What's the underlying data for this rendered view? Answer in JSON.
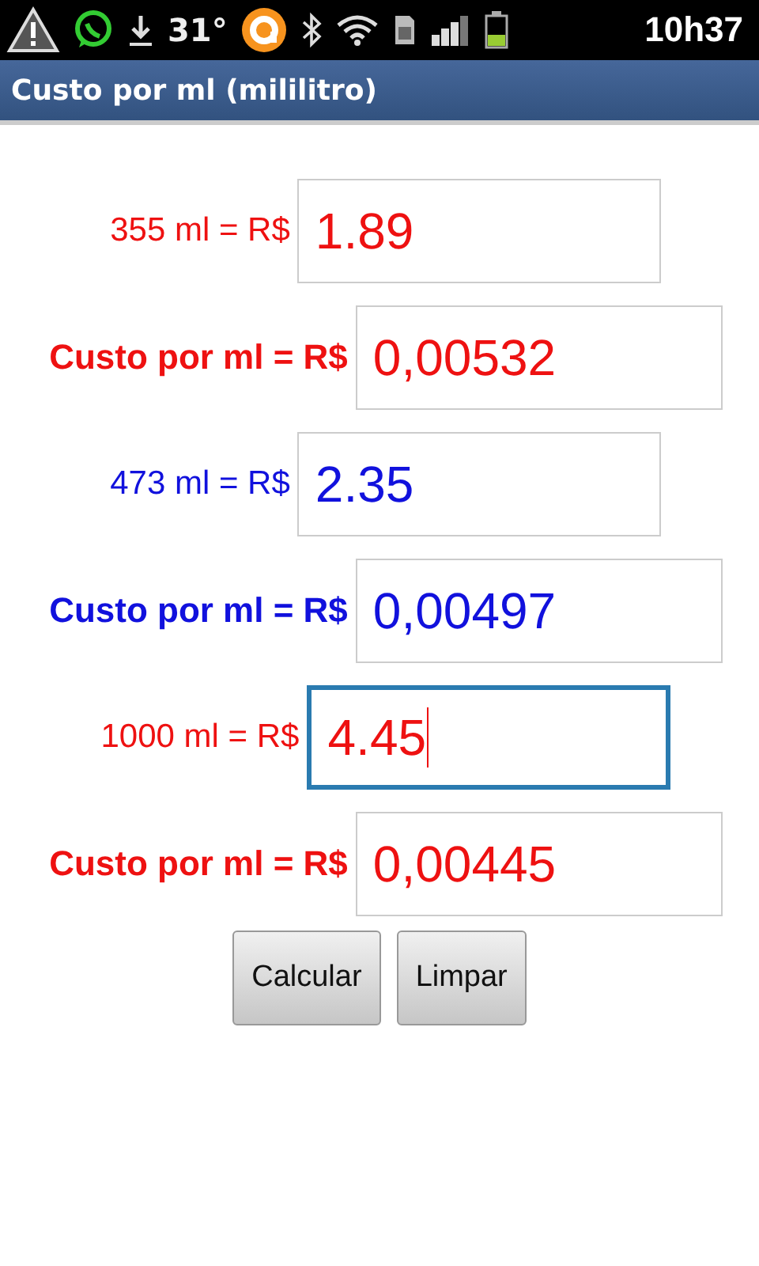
{
  "status_bar": {
    "temperature": "31°",
    "time": "10h37"
  },
  "title_bar": {
    "title": "Custo por ml (mililitro)"
  },
  "rows": [
    {
      "kind": "input",
      "label": "355 ml = R$",
      "value": "1.89",
      "color": "#ee1111",
      "focused": false
    },
    {
      "kind": "result",
      "label": "Custo por ml = R$",
      "value": "0,00532",
      "color": "#ee1111",
      "focused": false
    },
    {
      "kind": "input",
      "label": "473 ml = R$",
      "value": "2.35",
      "color": "#1111dd",
      "focused": false
    },
    {
      "kind": "result",
      "label": "Custo por ml = R$",
      "value": "0,00497",
      "color": "#1111dd",
      "focused": false
    },
    {
      "kind": "input",
      "label": "1000 ml = R$",
      "value": "4.45",
      "color": "#ee1111",
      "focused": true
    },
    {
      "kind": "result",
      "label": "Custo por ml = R$",
      "value": "0,00445",
      "color": "#ee1111",
      "focused": false
    }
  ],
  "buttons": [
    "Calcular",
    "Limpar"
  ]
}
